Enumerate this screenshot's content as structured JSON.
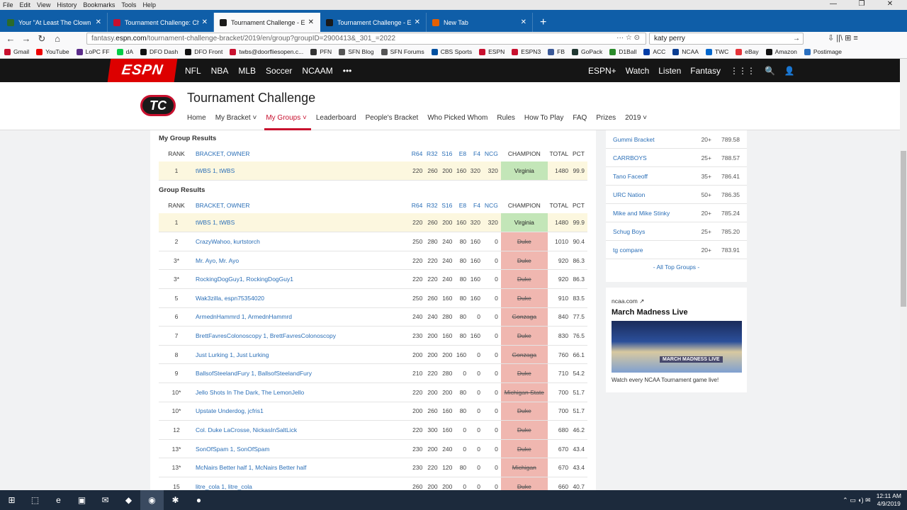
{
  "menu": [
    "File",
    "Edit",
    "View",
    "History",
    "Bookmarks",
    "Tools",
    "Help"
  ],
  "window_controls": [
    "—",
    "❐",
    "✕"
  ],
  "tabs": [
    {
      "title": "Your \"At Least The Clown Show",
      "color": "#2b6b2b",
      "active": false
    },
    {
      "title": "Tournament Challenge: Check",
      "color": "#c8102e",
      "active": false
    },
    {
      "title": "Tournament Challenge - ESPN",
      "color": "#1a1a1a",
      "active": true
    },
    {
      "title": "Tournament Challenge - ESPN",
      "color": "#1a1a1a",
      "active": false
    },
    {
      "title": "New Tab",
      "color": "#e66000",
      "active": false
    }
  ],
  "plus": "+",
  "nav": {
    "back": "←",
    "forward": "→",
    "reload": "↻",
    "home": "⌂"
  },
  "url": {
    "prefix": "fantasy.",
    "host": "espn.com",
    "path": "/tournament-challenge-bracket/2019/en/group?groupID=2900413&_301_=2022",
    "icons": "··· ☆ ⊙"
  },
  "search": {
    "value": "katy perry",
    "go": "→"
  },
  "toolbar_icons": "⇩ ||\\ ⊞ ≡",
  "bookmarks": [
    {
      "label": "Gmail",
      "color": "#c8102e"
    },
    {
      "label": "YouTube",
      "color": "#e00"
    },
    {
      "label": "LoPC FF",
      "color": "#5b2c8a"
    },
    {
      "label": "dA",
      "color": "#05cc47"
    },
    {
      "label": "DFO Dash",
      "color": "#111"
    },
    {
      "label": "DFO Front",
      "color": "#111"
    },
    {
      "label": "twbs@doorfliesopen.c...",
      "color": "#c8102e"
    },
    {
      "label": "PFN",
      "color": "#333"
    },
    {
      "label": "SFN Blog",
      "color": "#555"
    },
    {
      "label": "SFN Forums",
      "color": "#555"
    },
    {
      "label": "CBS Sports",
      "color": "#0050a0"
    },
    {
      "label": "ESPN",
      "color": "#c8102e"
    },
    {
      "label": "ESPN3",
      "color": "#c8102e"
    },
    {
      "label": "FB",
      "color": "#3b5998"
    },
    {
      "label": "GoPack",
      "color": "#203731"
    },
    {
      "label": "D1Ball",
      "color": "#2a8a2a"
    },
    {
      "label": "ACC",
      "color": "#013ca6"
    },
    {
      "label": "NCAA",
      "color": "#0a3d91"
    },
    {
      "label": "TWC",
      "color": "#0066cc"
    },
    {
      "label": "eBay",
      "color": "#e53238"
    },
    {
      "label": "Amazon",
      "color": "#111"
    },
    {
      "label": "Postimage",
      "color": "#2a6fbf"
    }
  ],
  "espn": {
    "logo": "ESPN",
    "nav": [
      "NFL",
      "NBA",
      "MLB",
      "Soccer",
      "NCAAM",
      "•••"
    ],
    "right": [
      "ESPN+",
      "Watch",
      "Listen",
      "Fantasy",
      "⋮⋮⋮",
      "🔍",
      "👤"
    ]
  },
  "tc": {
    "logo": "TC",
    "title": "Tournament Challenge",
    "nav": [
      "Home",
      "My Bracket ˅",
      "My Groups ˅",
      "Leaderboard",
      "People's Bracket",
      "Who Picked Whom",
      "Rules",
      "How To Play",
      "FAQ",
      "Prizes",
      "2019 ˅"
    ]
  },
  "my_results": {
    "heading": "My Group Results",
    "columns": [
      "RANK",
      "BRACKET, OWNER",
      "R64",
      "R32",
      "S16",
      "E8",
      "F4",
      "NCG",
      "CHAMPION",
      "TOTAL",
      "PCT"
    ],
    "rows": [
      {
        "rank": "1",
        "bracket": "tWBS 1,  tWBS",
        "r64": "220",
        "r32": "260",
        "s16": "200",
        "e8": "160",
        "f4": "320",
        "ncg": "320",
        "champion": "Virginia",
        "alive": true,
        "total": "1480",
        "pct": "99.9"
      }
    ]
  },
  "group_results": {
    "heading": "Group Results",
    "columns": [
      "RANK",
      "BRACKET, OWNER",
      "R64",
      "R32",
      "S16",
      "E8",
      "F4",
      "NCG",
      "CHAMPION",
      "TOTAL",
      "PCT"
    ],
    "rows": [
      {
        "rank": "1",
        "bracket": "tWBS 1,  tWBS",
        "r64": "220",
        "r32": "260",
        "s16": "200",
        "e8": "160",
        "f4": "320",
        "ncg": "320",
        "champion": "Virginia",
        "alive": true,
        "total": "1480",
        "pct": "99.9"
      },
      {
        "rank": "2",
        "bracket": "CrazyWahoo,  kurtstorch",
        "r64": "250",
        "r32": "280",
        "s16": "240",
        "e8": "80",
        "f4": "160",
        "ncg": "0",
        "champion": "Duke",
        "alive": false,
        "total": "1010",
        "pct": "90.4"
      },
      {
        "rank": "3*",
        "bracket": "Mr. Ayo,  Mr. Ayo",
        "r64": "220",
        "r32": "220",
        "s16": "240",
        "e8": "80",
        "f4": "160",
        "ncg": "0",
        "champion": "Duke",
        "alive": false,
        "total": "920",
        "pct": "86.3"
      },
      {
        "rank": "3*",
        "bracket": "RockingDogGuy1,  RockingDogGuy1",
        "r64": "220",
        "r32": "220",
        "s16": "240",
        "e8": "80",
        "f4": "160",
        "ncg": "0",
        "champion": "Duke",
        "alive": false,
        "total": "920",
        "pct": "86.3"
      },
      {
        "rank": "5",
        "bracket": "Wak3zilla,  espn75354020",
        "r64": "250",
        "r32": "260",
        "s16": "160",
        "e8": "80",
        "f4": "160",
        "ncg": "0",
        "champion": "Duke",
        "alive": false,
        "total": "910",
        "pct": "83.5"
      },
      {
        "rank": "6",
        "bracket": "ArmednHammrd 1,  ArmednHammrd",
        "r64": "240",
        "r32": "240",
        "s16": "280",
        "e8": "80",
        "f4": "0",
        "ncg": "0",
        "champion": "Gonzaga",
        "alive": false,
        "total": "840",
        "pct": "77.5"
      },
      {
        "rank": "7",
        "bracket": "BrettFavresColonoscopy 1,  BrettFavresColonoscopy",
        "r64": "230",
        "r32": "200",
        "s16": "160",
        "e8": "80",
        "f4": "160",
        "ncg": "0",
        "champion": "Duke",
        "alive": false,
        "total": "830",
        "pct": "76.5"
      },
      {
        "rank": "8",
        "bracket": "Just Lurking 1,  Just Lurking",
        "r64": "200",
        "r32": "200",
        "s16": "200",
        "e8": "160",
        "f4": "0",
        "ncg": "0",
        "champion": "Gonzaga",
        "alive": false,
        "total": "760",
        "pct": "66.1"
      },
      {
        "rank": "9",
        "bracket": "BallsofSteelandFury 1,  BallsofSteelandFury",
        "r64": "210",
        "r32": "220",
        "s16": "280",
        "e8": "0",
        "f4": "0",
        "ncg": "0",
        "champion": "Duke",
        "alive": false,
        "total": "710",
        "pct": "54.2"
      },
      {
        "rank": "10*",
        "bracket": "Jello Shots In The Dark,  The LemonJello",
        "r64": "220",
        "r32": "200",
        "s16": "200",
        "e8": "80",
        "f4": "0",
        "ncg": "0",
        "champion": "Michigan State",
        "alive": false,
        "total": "700",
        "pct": "51.7"
      },
      {
        "rank": "10*",
        "bracket": "Upstate Underdog,  jcfris1",
        "r64": "200",
        "r32": "260",
        "s16": "160",
        "e8": "80",
        "f4": "0",
        "ncg": "0",
        "champion": "Duke",
        "alive": false,
        "total": "700",
        "pct": "51.7"
      },
      {
        "rank": "12",
        "bracket": "Col. Duke LaCrosse,  NickasInSaltLick",
        "r64": "220",
        "r32": "300",
        "s16": "160",
        "e8": "0",
        "f4": "0",
        "ncg": "0",
        "champion": "Duke",
        "alive": false,
        "total": "680",
        "pct": "46.2"
      },
      {
        "rank": "13*",
        "bracket": "SonOfSpam 1,  SonOfSpam",
        "r64": "230",
        "r32": "200",
        "s16": "240",
        "e8": "0",
        "f4": "0",
        "ncg": "0",
        "champion": "Duke",
        "alive": false,
        "total": "670",
        "pct": "43.4"
      },
      {
        "rank": "13*",
        "bracket": "McNairs Better half 1,  McNairs Better half",
        "r64": "230",
        "r32": "220",
        "s16": "120",
        "e8": "80",
        "f4": "0",
        "ncg": "0",
        "champion": "Michigan",
        "alive": false,
        "total": "670",
        "pct": "43.4"
      },
      {
        "rank": "15",
        "bracket": "litre_cola 1,  litre_cola",
        "r64": "260",
        "r32": "200",
        "s16": "200",
        "e8": "0",
        "f4": "0",
        "ncg": "0",
        "champion": "Duke",
        "alive": false,
        "total": "660",
        "pct": "40.7"
      }
    ]
  },
  "top_groups": {
    "rows": [
      {
        "name": "Gummi Bracket",
        "count": "20+",
        "score": "789.58"
      },
      {
        "name": "CARRBOYS",
        "count": "25+",
        "score": "788.57"
      },
      {
        "name": "Tano Faceoff",
        "count": "35+",
        "score": "786.41"
      },
      {
        "name": "URC Nation",
        "count": "50+",
        "score": "786.35"
      },
      {
        "name": "Mike and Mike Stinky",
        "count": "20+",
        "score": "785.24"
      },
      {
        "name": "Schug Boys",
        "count": "25+",
        "score": "785.20"
      },
      {
        "name": "tg compare",
        "count": "20+",
        "score": "783.91"
      }
    ],
    "all_link": "- All Top Groups -"
  },
  "ad": {
    "source": "ncaa.com",
    "ext_icon": "↗",
    "title": "March Madness Live",
    "badge": "MARCH MADNESS LIVE",
    "caption": "Watch every NCAA Tournament game live!"
  },
  "taskbar": {
    "icons": [
      "⊞",
      "⬚",
      "e",
      "▣",
      "✉",
      "◆",
      "◉",
      "✱",
      "●"
    ],
    "time": "12:11 AM",
    "date": "4/9/2019",
    "tray": "⌃ ▭ ◖) ✉"
  }
}
